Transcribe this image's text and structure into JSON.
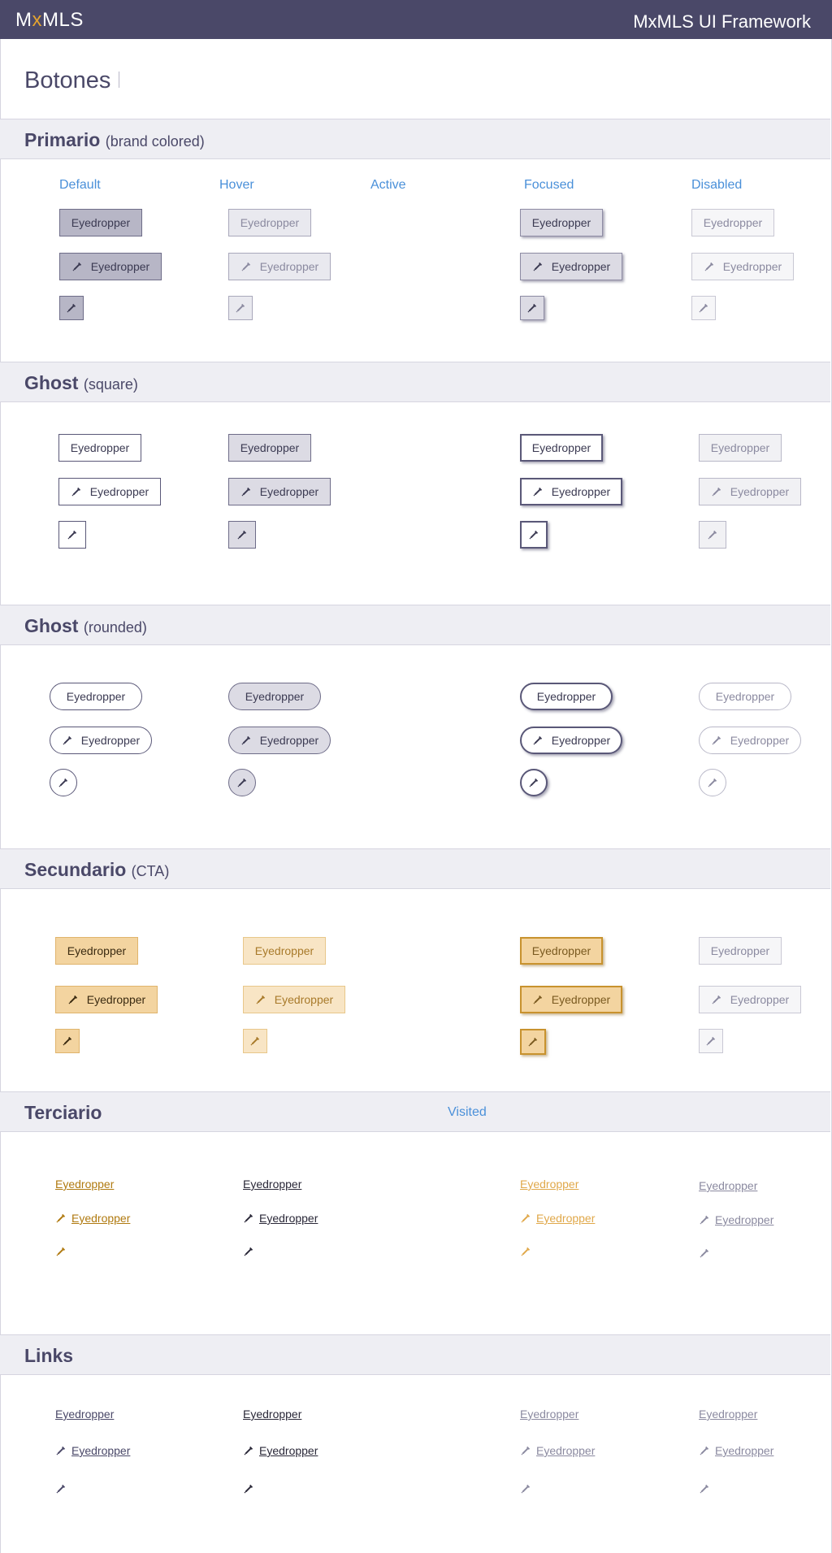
{
  "header": {
    "brand_pre": "M",
    "brand_x": "x",
    "brand_post": "MLS",
    "framework_title": "MxMLS UI Framework"
  },
  "page": {
    "title": "Botones"
  },
  "states": {
    "default": "Default",
    "hover": "Hover",
    "active": "Active",
    "focused": "Focused",
    "disabled": "Disabled",
    "visited": "Visited"
  },
  "sections": {
    "primario": {
      "title": "Primario",
      "subtitle": "(brand colored)"
    },
    "ghost_square": {
      "title": "Ghost",
      "subtitle": "(square)"
    },
    "ghost_rounded": {
      "title": "Ghost",
      "subtitle": "(rounded)"
    },
    "secundario": {
      "title": "Secundario",
      "subtitle": "(CTA)"
    },
    "terciario": {
      "title": "Terciario"
    },
    "links": {
      "title": "Links"
    }
  },
  "button": {
    "label": "Eyedropper",
    "icon": "eyedropper-icon"
  }
}
